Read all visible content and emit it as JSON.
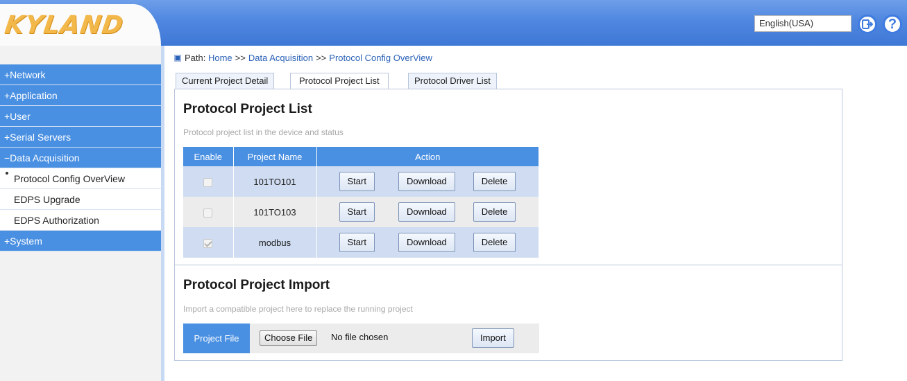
{
  "brand": {
    "logo_text": "KYLAND"
  },
  "header": {
    "language": "English(USA)",
    "logout_icon": "logout-icon",
    "help_icon": "help-icon"
  },
  "sidebar": {
    "items": [
      {
        "label": "+Network",
        "type": "main"
      },
      {
        "label": "+Application",
        "type": "main"
      },
      {
        "label": "+User",
        "type": "main"
      },
      {
        "label": "+Serial Servers",
        "type": "main"
      },
      {
        "label": "−Data Acquisition",
        "type": "main"
      },
      {
        "label": "Protocol Config OverView",
        "type": "sub",
        "active": true
      },
      {
        "label": "EDPS Upgrade",
        "type": "sub"
      },
      {
        "label": "EDPS Authorization",
        "type": "sub"
      },
      {
        "label": "+System",
        "type": "main"
      }
    ]
  },
  "breadcrumb": {
    "prefix": "Path:",
    "items": [
      "Home",
      "Data Acquisition",
      "Protocol Config OverView"
    ],
    "separator": ">>"
  },
  "tabs": [
    {
      "label": "Current Project Detail",
      "active": false
    },
    {
      "label": "Protocol Project List",
      "active": true
    },
    {
      "label": "Protocol Driver List",
      "active": false
    }
  ],
  "project_list": {
    "title": "Protocol Project List",
    "description": "Protocol project list in the device and status",
    "columns": [
      "Enable",
      "Project Name",
      "Action"
    ],
    "rows": [
      {
        "enabled": false,
        "name": "101TO101"
      },
      {
        "enabled": false,
        "name": "101TO103"
      },
      {
        "enabled": true,
        "name": "modbus"
      }
    ],
    "actions": {
      "start": "Start",
      "download": "Download",
      "delete": "Delete"
    }
  },
  "project_import": {
    "title": "Protocol Project Import",
    "description": "Import a compatible project here to replace the running project",
    "file_label": "Project File",
    "choose_file": "Choose File",
    "no_file": "No file chosen",
    "import_button": "Import"
  },
  "colors": {
    "accent": "#4a90e2",
    "header": "#4f87e0",
    "logo": "#f3b84a"
  }
}
